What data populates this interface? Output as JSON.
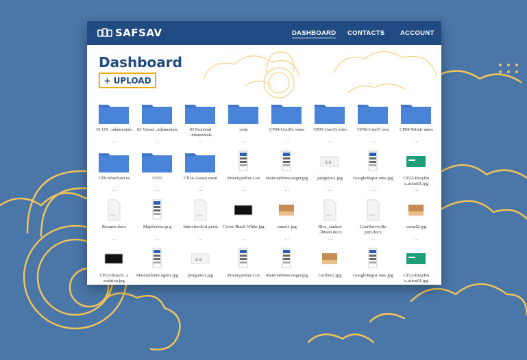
{
  "app": {
    "logo_text": "SAFSAV"
  },
  "nav": {
    "dashboard": "DASHBOARD",
    "contacts": "CONTACTS",
    "account": "ACCOUNT"
  },
  "page": {
    "title": "Dashboard",
    "upload_label": "+ UPLOAD",
    "more": "..."
  },
  "colors": {
    "background": "#4a77a8",
    "header": "#1f4a82",
    "accent": "#f2a900",
    "folder": "#3f76c9"
  },
  "files": [
    {
      "name": "01 UX ..ndamentals",
      "type": "folder"
    },
    {
      "name": "02 Visual ..ndamentals",
      "type": "folder"
    },
    {
      "name": "03 Frontend ..ndamentals",
      "type": "folder"
    },
    {
      "name": "code",
      "type": "folder"
    },
    {
      "name": "CP04-UserPe rsona",
      "type": "folder"
    },
    {
      "name": "CP05-UserSt ories",
      "type": "folder"
    },
    {
      "name": "CP06-UserFl ows",
      "type": "folder"
    },
    {
      "name": "CP08-Wirefr ames",
      "type": "folder"
    },
    {
      "name": "CP9-Wirefram es",
      "type": "folder"
    },
    {
      "name": "CP11",
      "type": "folder"
    },
    {
      "name": "CP14-Assess ment",
      "type": "folder"
    },
    {
      "name": "PrototypeBus List",
      "type": "phone-image"
    },
    {
      "name": "MaterialMess enger.jpg",
      "type": "phone-image"
    },
    {
      "name": "penguins1.jpg",
      "type": "sketch-image"
    },
    {
      "name": "GoogleMapsr oute.jpg",
      "type": "phone-image"
    },
    {
      "name": "CP22-BusyBu s..ation01.jpg",
      "type": "green-image"
    },
    {
      "name": "Resume.docx",
      "type": "document"
    },
    {
      "name": "MapScreen.jp g",
      "type": "phone-image"
    },
    {
      "name": "InterviewScri pt.txt",
      "type": "document"
    },
    {
      "name": "Cover-Black White.jpg",
      "type": "black-image"
    },
    {
      "name": "camel1.jpg",
      "type": "photo-image"
    },
    {
      "name": "Bloc_student ..llment.docx",
      "type": "document"
    },
    {
      "name": "UserSurveyRe port.docx",
      "type": "document"
    },
    {
      "name": "camel2.jpg",
      "type": "photo-image"
    },
    {
      "name": "CP22-BusyB...s entation.jpg",
      "type": "black-image"
    },
    {
      "name": "MaterialSetti ngs#1.jpg",
      "type": "phone-image"
    },
    {
      "name": "penguins1.jpg",
      "type": "sketch-image"
    },
    {
      "name": "PrototypeBus List",
      "type": "phone-image"
    },
    {
      "name": "MaterialMess enger.jpg",
      "type": "phone-image"
    },
    {
      "name": "Caribou1.jpg",
      "type": "photo-image"
    },
    {
      "name": "GoogleMapsr oute.jpg",
      "type": "phone-image"
    },
    {
      "name": "CP22-BusyBu s..ation01.jpg",
      "type": "green-image"
    }
  ]
}
